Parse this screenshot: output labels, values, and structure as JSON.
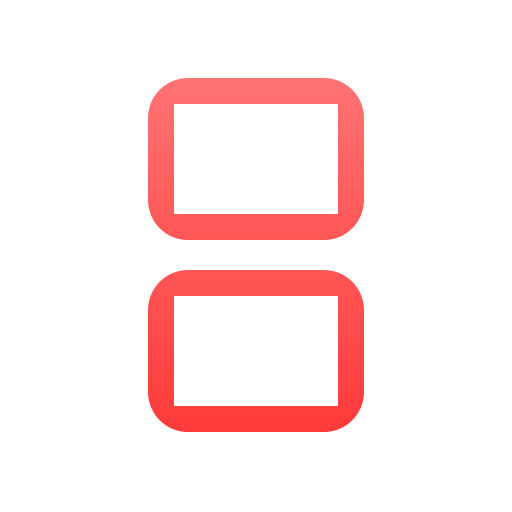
{
  "icon": {
    "name": "dual-screen-icon",
    "colors": {
      "top_light": "#ff7373",
      "mid": "#ff5656",
      "bottom_deep": "#ff3a3a",
      "background": "#ffffff",
      "screen_fill": "#ffffff"
    }
  }
}
